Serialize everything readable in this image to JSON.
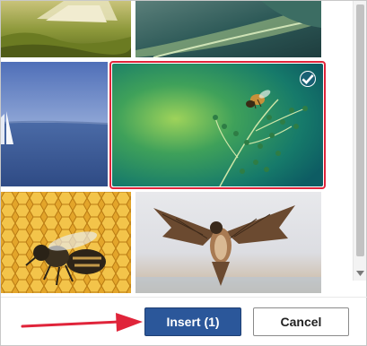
{
  "dialog": {
    "images": [
      {
        "name": "tent-in-grass"
      },
      {
        "name": "green-leaf-closeup"
      },
      {
        "name": "sailboat-on-lake"
      },
      {
        "name": "bee-on-green-plant",
        "selected": true
      },
      {
        "name": "bee-on-honeycomb"
      },
      {
        "name": "falcon-in-flight"
      }
    ],
    "insert_label": "Insert (1)",
    "cancel_label": "Cancel"
  },
  "colors": {
    "insert_button": "#2b579a",
    "selection_border": "#e0243a",
    "annotation_arrow": "#e0243a"
  },
  "icons": {
    "selected_check": "checkmark-circle-icon",
    "scroll_down": "chevron-down-icon"
  }
}
